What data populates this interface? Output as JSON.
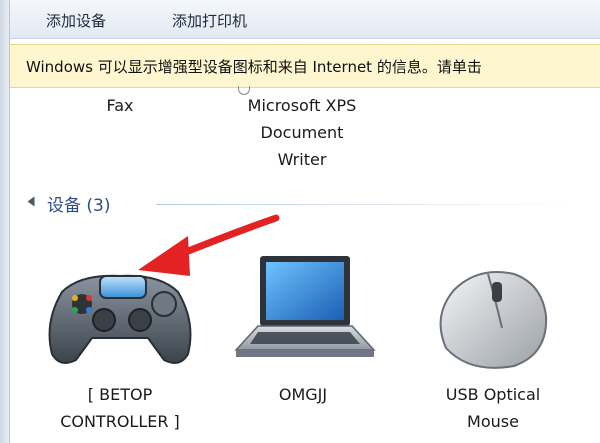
{
  "toolbar": {
    "add_device": "添加设备",
    "add_printer": "添加打印机"
  },
  "infobar": {
    "text": "Windows 可以显示增强型设备图标和来自 Internet 的信息。请单击"
  },
  "printers_partial": {
    "fax_label": "Fax",
    "xps_label_line1": "Microsoft XPS",
    "xps_label_line2": "Document",
    "xps_label_line3": "Writer"
  },
  "devices_group": {
    "title": "设备 (3)"
  },
  "devices": [
    {
      "line1": "[ BETOP",
      "line2": "CONTROLLER ]",
      "icon": "gamepad-icon"
    },
    {
      "line1": "OMGJJ",
      "line2": "",
      "icon": "laptop-icon"
    },
    {
      "line1": "USB Optical",
      "line2": "Mouse",
      "icon": "mouse-icon"
    }
  ],
  "annotation": {
    "color": "#e32323"
  },
  "colors": {
    "group_title": "#2b4f86",
    "infobar_bg": "#fdf6cf"
  }
}
